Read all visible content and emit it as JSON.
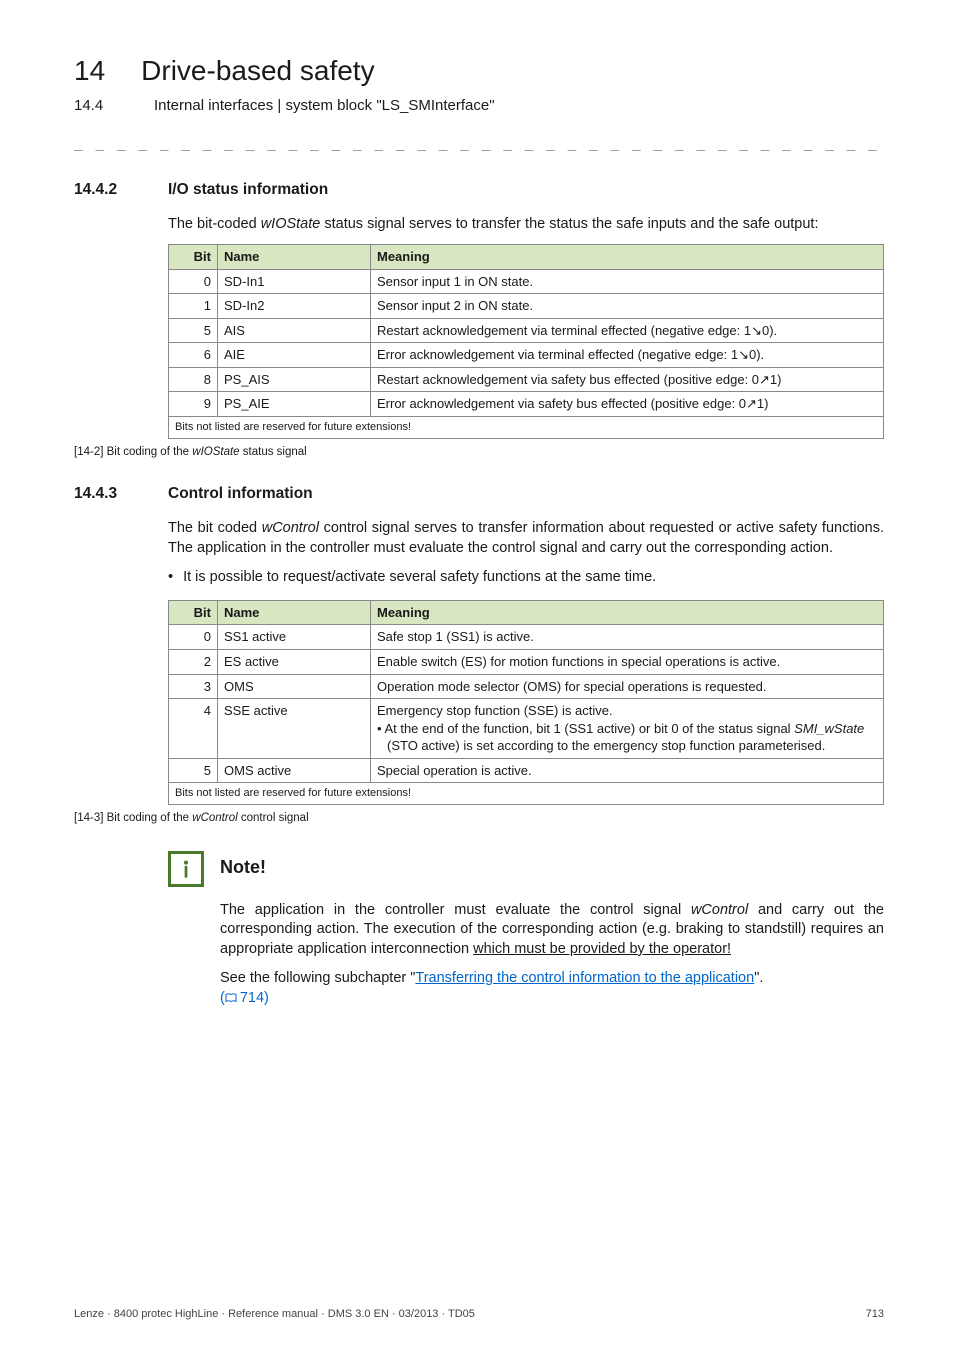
{
  "chapter": {
    "num": "14",
    "title": "Drive-based safety"
  },
  "subchapter": {
    "num": "14.4",
    "title": "Internal interfaces | system block \"LS_SMInterface\""
  },
  "rule": "_ _ _ _ _ _ _ _ _ _ _ _ _ _ _ _ _ _ _ _ _ _ _ _ _ _ _ _ _ _ _ _ _ _ _ _ _ _ _ _ _ _ _ _ _ _ _ _ _ _ _ _ _ _ _ _ _ _ _ _ _ _ _ _",
  "sect_io": {
    "num": "14.4.2",
    "title": "I/O status information",
    "para": [
      "The bit-coded ",
      "wIOState",
      " status signal serves to transfer the status the safe inputs and the safe output:"
    ],
    "cols": {
      "bit": "Bit",
      "name": "Name",
      "meaning": "Meaning"
    },
    "rows": [
      {
        "bit": "0",
        "name": "SD-In1",
        "meaning": "Sensor input 1 in ON state."
      },
      {
        "bit": "1",
        "name": "SD-In2",
        "meaning": "Sensor input 2 in ON state."
      },
      {
        "bit": "5",
        "name": "AIS",
        "meaning": "Restart acknowledgement via terminal effected (negative edge: 1↘0)."
      },
      {
        "bit": "6",
        "name": "AIE",
        "meaning": "Error acknowledgement via terminal effected (negative edge: 1↘0)."
      },
      {
        "bit": "8",
        "name": "PS_AIS",
        "meaning": "Restart acknowledgement via safety bus effected (positive edge: 0↗1)"
      },
      {
        "bit": "9",
        "name": "PS_AIE",
        "meaning": "Error acknowledgement via safety bus effected (positive edge: 0↗1)"
      }
    ],
    "footnote": "Bits not listed are reserved for future extensions!",
    "caption_prefix": "[14-2]   Bit coding of the ",
    "caption_signal": "wIOState",
    "caption_suffix": " status signal"
  },
  "sect_ctrl": {
    "num": "14.4.3",
    "title": "Control information",
    "para": [
      "The bit coded ",
      "wControl",
      " control signal serves to transfer information about requested or active safety functions. The application in the controller must evaluate the control signal and carry out the corresponding action."
    ],
    "bullet": "It is possible to request/activate several safety functions at the same time.",
    "cols": {
      "bit": "Bit",
      "name": "Name",
      "meaning": "Meaning"
    },
    "rows_simple": [
      {
        "bit": "0",
        "name": "SS1 active",
        "meaning": "Safe stop 1 (SS1) is active."
      },
      {
        "bit": "2",
        "name": "ES active",
        "meaning": "Enable switch (ES) for motion functions in special operations is active."
      },
      {
        "bit": "3",
        "name": "OMS",
        "meaning": "Operation mode selector (OMS) for special operations is requested."
      }
    ],
    "row_sse": {
      "bit": "4",
      "name": "SSE active",
      "line1": "Emergency stop function (SSE) is active.",
      "sub_pre": "• At the end of the function, bit 1 (SS1 active) or bit 0 of the status signal ",
      "sub_sig": "SMI_wState",
      "sub_post": " (STO active) is set according to the emergency stop function parameterised."
    },
    "row_last": {
      "bit": "5",
      "name": "OMS active",
      "meaning": "Special operation is active."
    },
    "footnote": "Bits not listed are reserved for future extensions!",
    "caption_prefix": "[14-3]   Bit coding of the ",
    "caption_signal": "wControl",
    "caption_suffix": " control signal"
  },
  "note": {
    "title": "Note!",
    "p1_pre": "The application in the controller must evaluate the control signal ",
    "p1_sig": "wControl",
    "p1_mid": " and carry out the corresponding action. The execution of the corresponding action (e.g. braking to standstill) requires an appropriate application interconnection ",
    "p1_uline": "which must be provided by the operator!",
    "p2_pre": "See the following subchapter \"",
    "p2_link": "Transferring the control information to the application",
    "p2_post": "\". ",
    "p2_ref": "714"
  },
  "footer": {
    "left": "Lenze · 8400 protec HighLine · Reference manual · DMS 3.0 EN · 03/2013 · TD05",
    "right": "713"
  }
}
